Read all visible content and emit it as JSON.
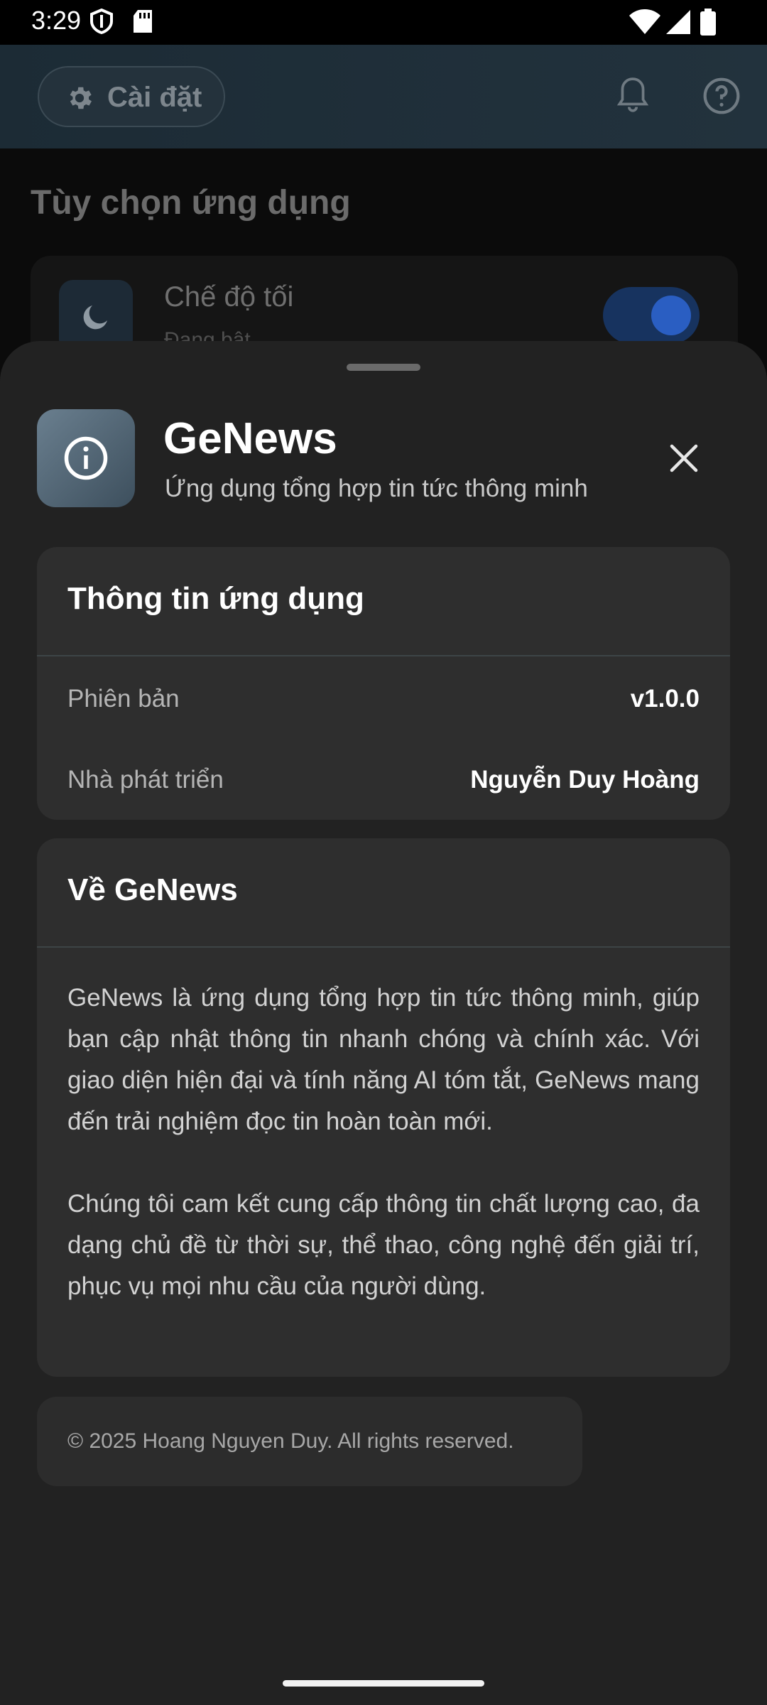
{
  "status_bar": {
    "time": "3:29"
  },
  "background": {
    "appbar": {
      "settings_label": "Cài đặt"
    },
    "section_title": "Tùy chọn ứng dụng",
    "dark_mode": {
      "title": "Chế độ tối",
      "subtitle": "Đang bật",
      "enabled": true
    }
  },
  "sheet": {
    "app_name": "GeNews",
    "tagline": "Ứng dụng tổng hợp tin tức thông minh",
    "info_card": {
      "title": "Thông tin ứng dụng",
      "rows": [
        {
          "label": "Phiên bản",
          "value": "v1.0.0"
        },
        {
          "label": "Nhà phát triển",
          "value": "Nguyễn Duy Hoàng"
        }
      ]
    },
    "about_card": {
      "title": "Về GeNews",
      "paragraphs": [
        "GeNews là ứng dụng tổng hợp tin tức thông minh, giúp bạn cập nhật thông tin nhanh chóng và chính xác. Với giao diện hiện đại và tính năng AI tóm tắt, GeNews mang đến trải nghiệm đọc tin hoàn toàn mới.",
        "Chúng tôi cam kết cung cấp thông tin chất lượng cao, đa dạng chủ đề từ thời sự, thể thao, công nghệ đến giải trí, phục vụ mọi nhu cầu của người dùng."
      ]
    },
    "copyright": "© 2025 Hoang Nguyen Duy. All rights reserved."
  },
  "colors": {
    "sheet_bg": "#222222",
    "card_bg": "#2e2e2e",
    "toggle_on": "#2a5ec2"
  }
}
